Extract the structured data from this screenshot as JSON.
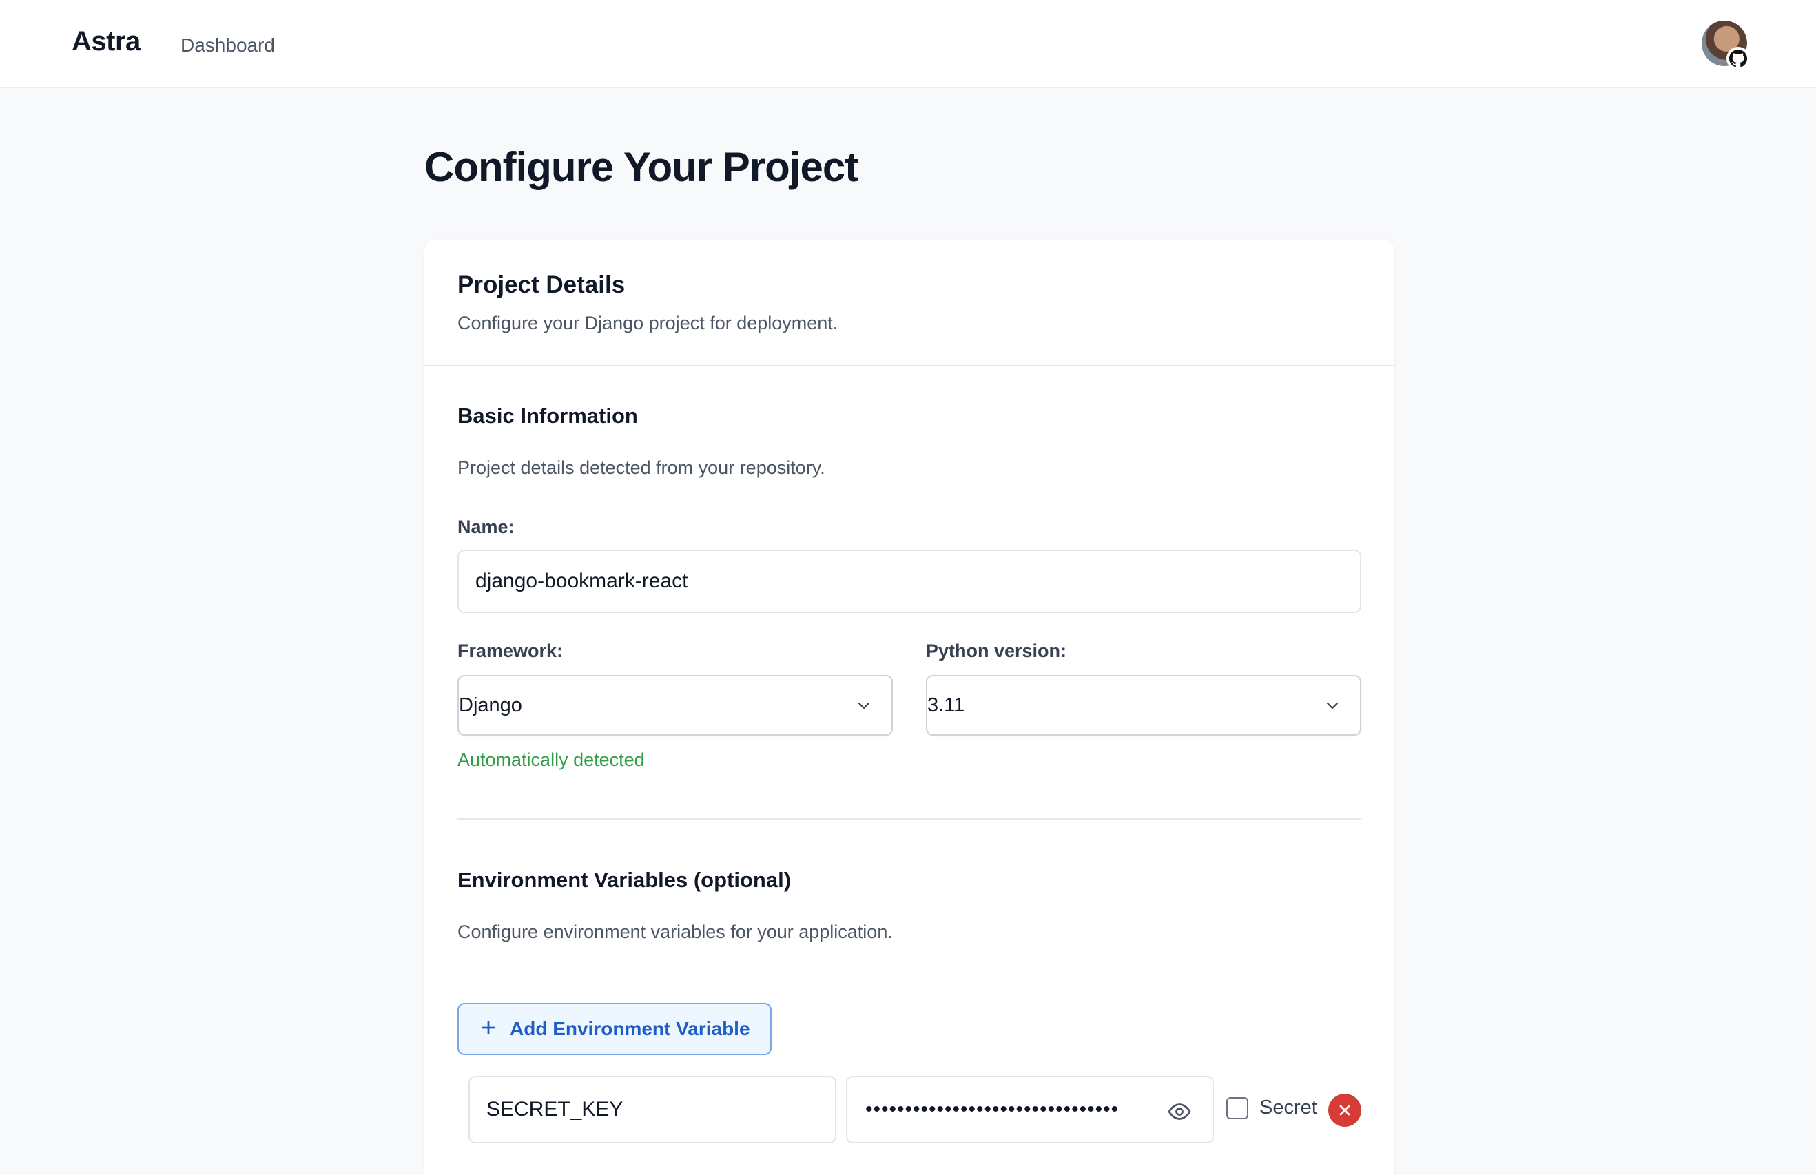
{
  "header": {
    "brand": "Astra",
    "nav": {
      "dashboard": "Dashboard"
    },
    "avatar_icon": "github-icon"
  },
  "page": {
    "title": "Configure Your Project"
  },
  "card": {
    "title": "Project Details",
    "subtitle": "Configure your Django project for deployment."
  },
  "basic": {
    "title": "Basic Information",
    "description": "Project details detected from your repository.",
    "name_label": "Name:",
    "name_value": "django-bookmark-react",
    "framework_label": "Framework:",
    "framework_value": "Django",
    "python_label": "Python version:",
    "python_value": "3.11",
    "detected_note": "Automatically detected"
  },
  "env": {
    "title": "Environment Variables (optional)",
    "description": "Configure environment variables for your application.",
    "add_label": "Add Environment Variable",
    "rows": [
      {
        "key": "SECRET_KEY",
        "masked_value": "••••••••••••••••••••••••••••••••",
        "secret_label": "Secret"
      }
    ]
  },
  "colors": {
    "accent": "#1d5fc7",
    "success": "#2f9e44",
    "danger": "#d63b35"
  }
}
